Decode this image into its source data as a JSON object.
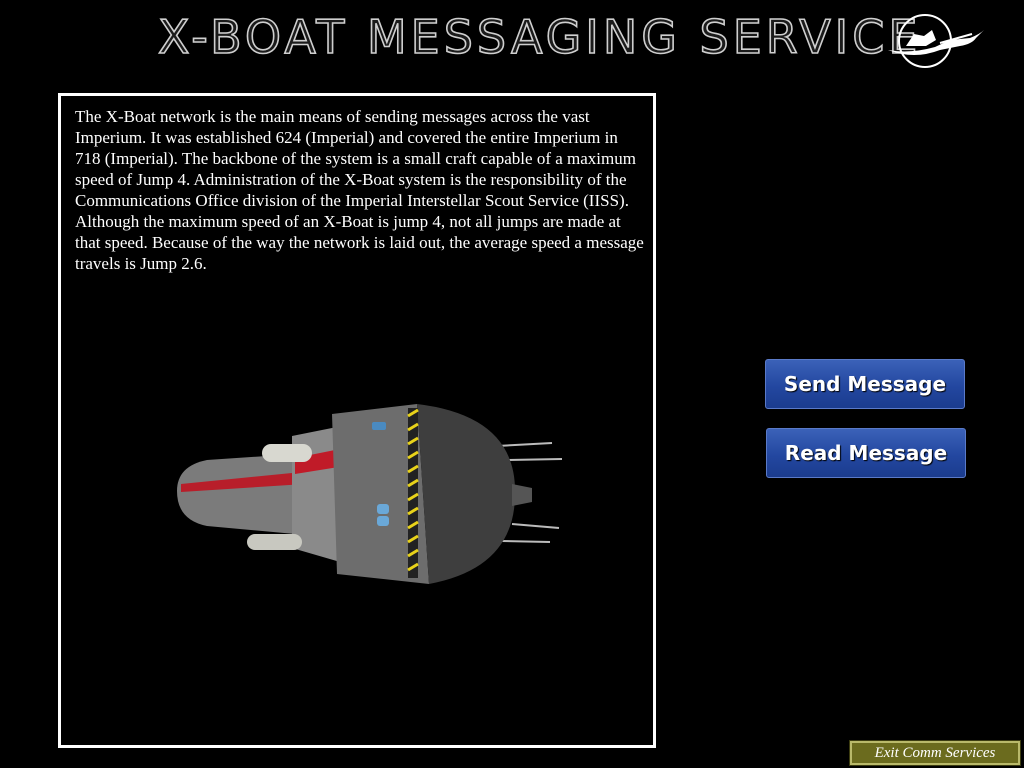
{
  "header": {
    "title": "X-Boat Messaging Service",
    "logo_icon": "scout-service-logo-icon"
  },
  "main": {
    "description": "The X-Boat network is the main means of sending messages across the vast Imperium. It was established 624 (Imperial) and covered the entire Imperium in 718 (Imperial). The backbone of the system is a small craft capable of a maximum speed of Jump 4. Administration of the X-Boat system is the responsibility of the Communications Office division of the Imperial Interstellar Scout Service (IISS). Although the maximum speed of an X-Boat is jump 4, not all jumps are made at that speed. Because of the way the network is laid out, the average speed a message travels is Jump 2.6.",
    "image_icon": "x-boat-ship-image"
  },
  "actions": {
    "send_label": "Send Message",
    "read_label": "Read Message",
    "exit_label": "Exit Comm Services"
  },
  "colors": {
    "background": "#000000",
    "button_blue": "#2347a0",
    "exit_olive": "#6b6b1e"
  }
}
